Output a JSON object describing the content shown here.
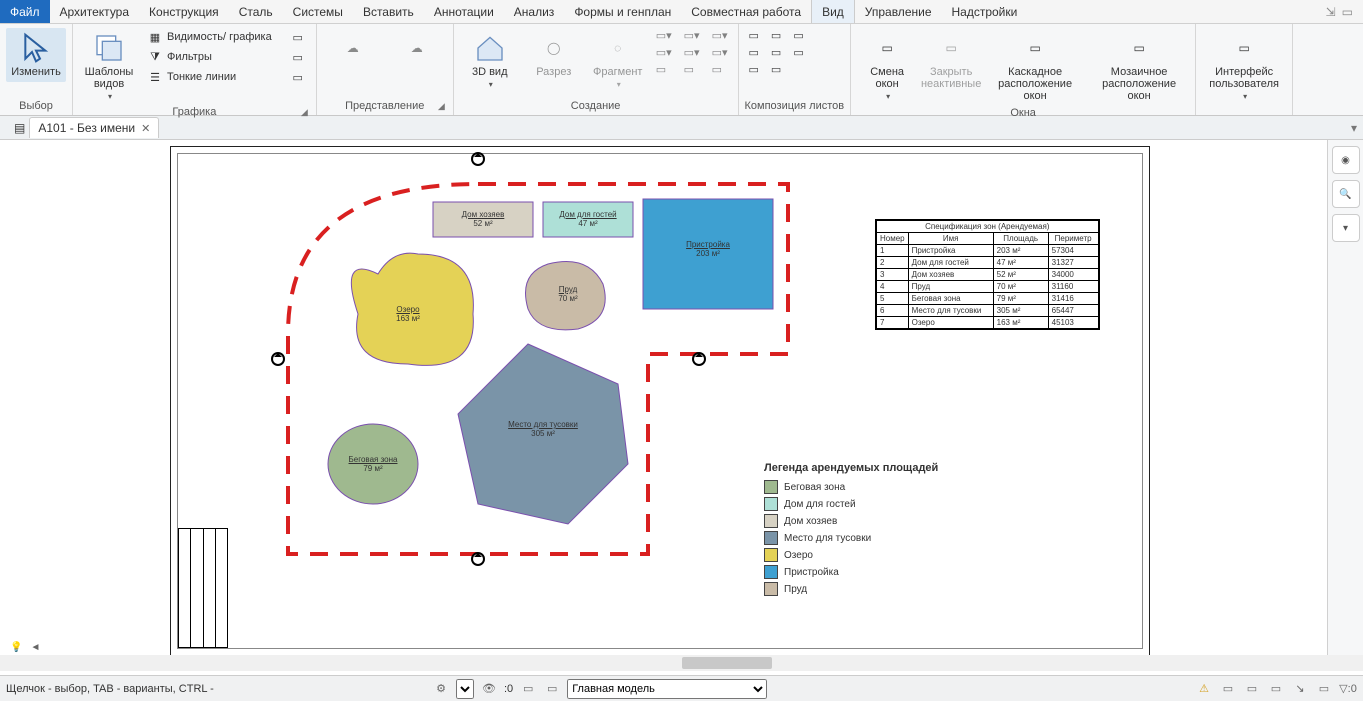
{
  "menu": [
    "Файл",
    "Архитектура",
    "Конструкция",
    "Сталь",
    "Системы",
    "Вставить",
    "Аннотации",
    "Анализ",
    "Формы и генплан",
    "Совместная работа",
    "Вид",
    "Управление",
    "Надстройки"
  ],
  "activeMenuIndex": 10,
  "ribbon": {
    "groups": [
      {
        "title": "Выбор",
        "launcher": true,
        "large": [
          {
            "icon": "cursor",
            "label": "Изменить",
            "sel": true
          }
        ]
      },
      {
        "title": "Графика",
        "launcher": true,
        "large": [
          {
            "icon": "templates",
            "label": "Шаблоны видов"
          }
        ],
        "small": [
          {
            "icon": "vis",
            "label": "Видимость/ графика"
          },
          {
            "icon": "filter",
            "label": "Фильтры"
          },
          {
            "icon": "thin",
            "label": "Тонкие линии"
          }
        ],
        "extra": [
          {
            "icon": "b1"
          },
          {
            "icon": "b2"
          },
          {
            "icon": "b3"
          }
        ]
      },
      {
        "title": "Представление",
        "launcher": true,
        "faded": true,
        "large": [
          {
            "icon": "blob",
            "label": ""
          },
          {
            "icon": "blob2",
            "label": ""
          }
        ]
      },
      {
        "title": "Создание",
        "launcher": false,
        "large": [
          {
            "icon": "3d",
            "label": "3D вид"
          },
          {
            "icon": "section",
            "label": "Разрез",
            "faded": true
          },
          {
            "icon": "callout",
            "label": "Фрагмент",
            "faded": true
          }
        ],
        "extraCols": 3
      },
      {
        "title": "Композиция листов",
        "launcher": false,
        "iconsGrid": 6
      },
      {
        "title": "Окна",
        "launcher": false,
        "large": [
          {
            "icon": "switch",
            "label": "Смена окон"
          },
          {
            "icon": "close",
            "label": "Закрыть неактивные",
            "disabled": true
          },
          {
            "icon": "cascade",
            "label": "Каскадное расположение окон"
          },
          {
            "icon": "tile",
            "label": "Мозаичное расположение окон"
          }
        ]
      },
      {
        "title": "",
        "large": [
          {
            "icon": "ui",
            "label": "Интерфейс пользователя"
          }
        ]
      }
    ]
  },
  "doctab": {
    "label": "A101 - Без имени"
  },
  "areas": [
    {
      "name": "Дом хозяев",
      "area": "52 м²"
    },
    {
      "name": "Дом для гостей",
      "area": "47 м²"
    },
    {
      "name": "Пристройка",
      "area": "203 м²"
    },
    {
      "name": "Озеро",
      "area": "163 м²"
    },
    {
      "name": "Пруд",
      "area": "70 м²"
    },
    {
      "name": "Место для тусовки",
      "area": "305 м²"
    },
    {
      "name": "Беговая зона",
      "area": "79 м²"
    }
  ],
  "schedule": {
    "title": "Спецификация зон (Арендуемая)",
    "headers": [
      "Номер",
      "Имя",
      "Площадь",
      "Периметр"
    ],
    "rows": [
      [
        "1",
        "Пристройка",
        "203 м²",
        "57304"
      ],
      [
        "2",
        "Дом для гостей",
        "47 м²",
        "31327"
      ],
      [
        "3",
        "Дом хозяев",
        "52 м²",
        "34000"
      ],
      [
        "4",
        "Пруд",
        "70 м²",
        "31160"
      ],
      [
        "5",
        "Беговая зона",
        "79 м²",
        "31416"
      ],
      [
        "6",
        "Место для тусовки",
        "305 м²",
        "65447"
      ],
      [
        "7",
        "Озеро",
        "163 м²",
        "45103"
      ]
    ]
  },
  "legend": {
    "title": "Легенда арендуемых площадей",
    "items": [
      {
        "label": "Беговая зона",
        "color": "#9fb98f"
      },
      {
        "label": "Дом для гостей",
        "color": "#aee0d7"
      },
      {
        "label": "Дом хозяев",
        "color": "#d7d2c4"
      },
      {
        "label": "Место для тусовки",
        "color": "#7a94a8"
      },
      {
        "label": "Озеро",
        "color": "#e4d256"
      },
      {
        "label": "Пристройка",
        "color": "#3ea0d1"
      },
      {
        "label": "Пруд",
        "color": "#c9bba7"
      }
    ]
  },
  "status": {
    "hint": "Щелчок - выбор, TAB - варианты, CTRL -",
    "scale": ":0",
    "modelCombo": "Главная модель"
  }
}
